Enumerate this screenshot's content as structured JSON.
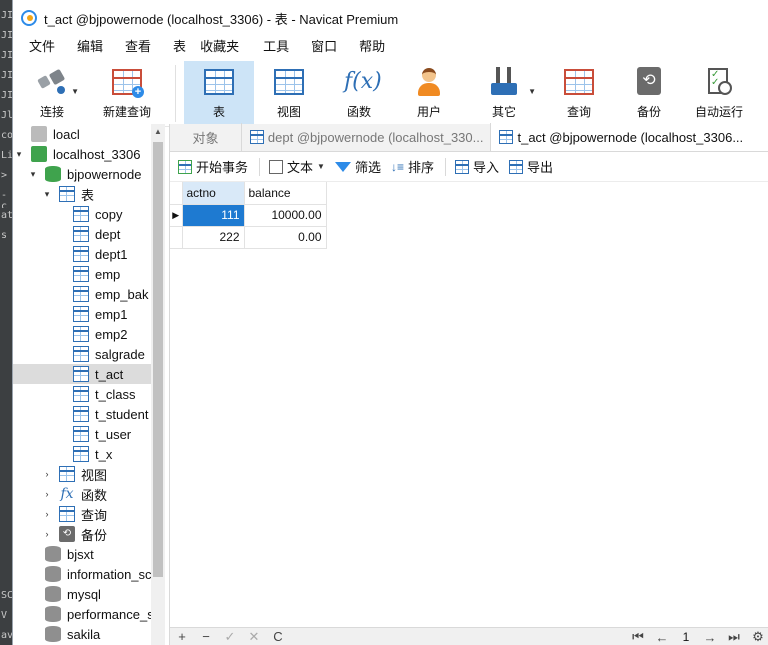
{
  "background_strip": {
    "rows": [
      "JI",
      "JI",
      "JI",
      "JI",
      "JI",
      "Jl",
      "co",
      "Li",
      ">",
      "-c",
      "at",
      "s",
      "",
      "",
      "",
      "",
      "",
      "",
      "",
      "",
      "",
      "",
      "",
      "",
      "",
      "",
      "",
      "",
      "",
      "SC",
      "V",
      "av"
    ]
  },
  "titlebar": {
    "title": "t_act @bjpowernode (localhost_3306) - 表 - Navicat Premium"
  },
  "menu": [
    "文件",
    "编辑",
    "查看",
    "表",
    "收藏夹",
    "工具",
    "窗口",
    "帮助"
  ],
  "toolbar": {
    "connect": "连接",
    "new_query": "新建查询",
    "table": "表",
    "view": "视图",
    "function": "函数",
    "user": "用户",
    "other": "其它",
    "query": "查询",
    "backup": "备份",
    "automation": "自动运行"
  },
  "sidebar": {
    "connections": [
      "loacl",
      "localhost_3306"
    ],
    "database": "bjpowernode",
    "tables_group": "表",
    "tables": [
      "copy",
      "dept",
      "dept1",
      "emp",
      "emp_bak",
      "emp1",
      "emp2",
      "salgrade",
      "t_act",
      "t_class",
      "t_student",
      "t_user",
      "t_x"
    ],
    "selected_table": "t_act",
    "groups": [
      "视图",
      "函数",
      "查询",
      "备份"
    ],
    "other_databases": [
      "bjsxt",
      "information_sc",
      "mysql",
      "performance_s",
      "sakila"
    ]
  },
  "tabs": {
    "objects": "对象",
    "tab2": "dept @bjpowernode (localhost_330...",
    "tab3": "t_act @bjpowernode (localhost_3306..."
  },
  "subtoolbar": {
    "begin_transaction": "开始事务",
    "text": "文本",
    "filter": "筛选",
    "sort": "排序",
    "import": "导入",
    "export": "导出"
  },
  "grid": {
    "columns": [
      "actno",
      "balance"
    ],
    "rows": [
      {
        "actno": "111",
        "balance": "10000.00"
      },
      {
        "actno": "222",
        "balance": "0.00"
      }
    ]
  },
  "bottom_bar": {
    "add": "+",
    "delete": "−",
    "apply": "✓",
    "cancel": "✕",
    "refresh": "C",
    "page": "1"
  },
  "colors": {
    "accent": "#1e7ad1",
    "toolbar_active": "#cde4f7",
    "table_icon": "#2e6fb5",
    "db_icon": "#3fa34d"
  }
}
